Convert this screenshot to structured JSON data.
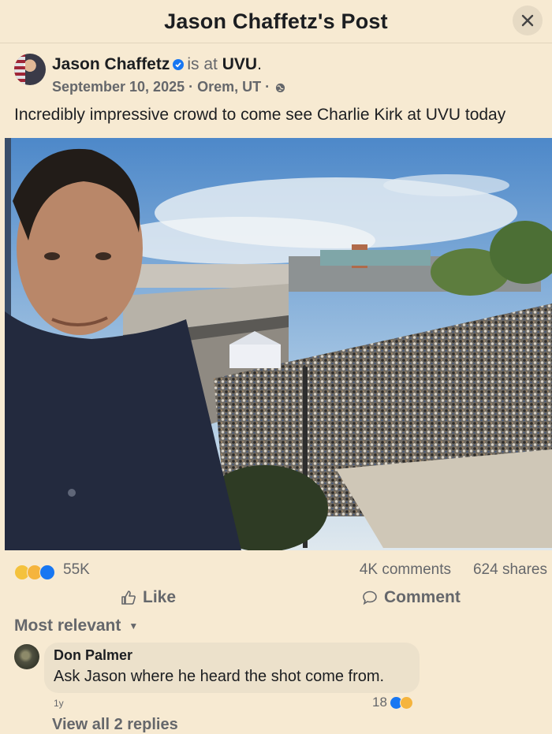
{
  "header": {
    "title": "Jason Chaffetz's Post",
    "close_icon": "close-icon"
  },
  "post": {
    "author": "Jason Chaffetz",
    "is_at": "is at",
    "place": "UVU",
    "period": ".",
    "date": "September 10, 2025",
    "separator": " · ",
    "location": "Orem, UT",
    "separator2": " ·",
    "privacy_icon": "globe-icon",
    "text": "Incredibly impressive crowd to come see Charlie Kirk at UVU today"
  },
  "stats": {
    "reaction_icons": [
      "care-icon",
      "haha-icon",
      "like-icon"
    ],
    "reaction_count": "55K",
    "comments": "4K comments",
    "shares": "624 shares"
  },
  "actions": {
    "like": "Like",
    "comment": "Comment"
  },
  "comments_section": {
    "sort_label": "Most relevant",
    "comment": {
      "author": "Don Palmer",
      "text": "Ask Jason where he heard the shot come from.",
      "time": "1y",
      "reaction_count": "18",
      "view_replies": "View all 2 replies"
    }
  },
  "colors": {
    "background": "#f7ead2",
    "like_blue": "#1877f2",
    "muted": "#65676b"
  }
}
